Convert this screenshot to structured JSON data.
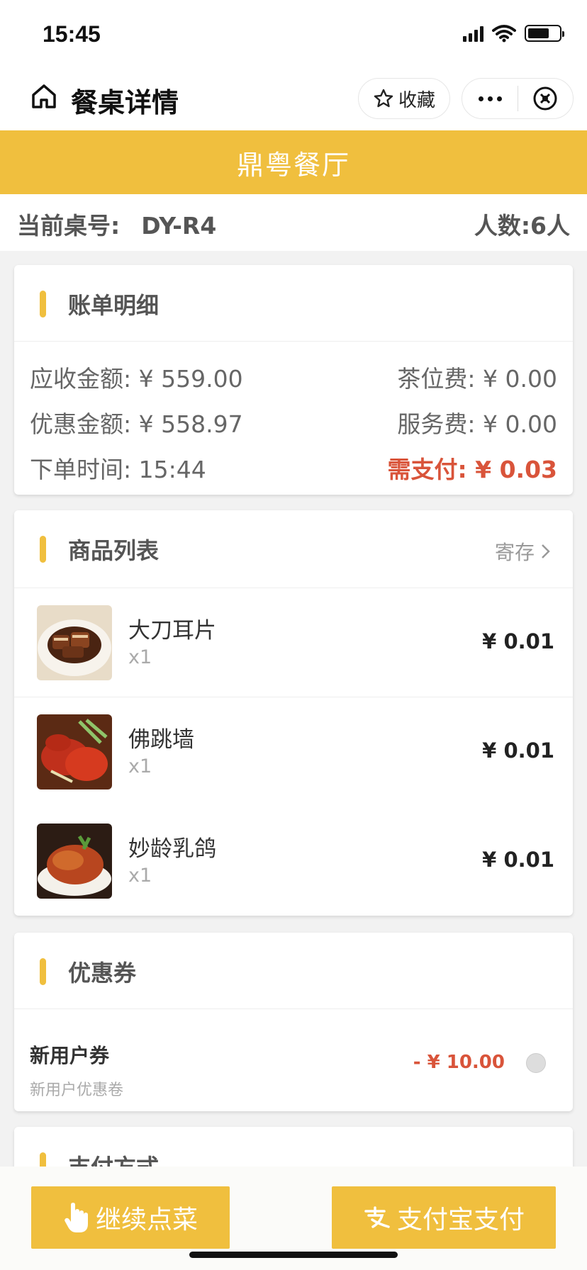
{
  "status_bar": {
    "time": "15:45"
  },
  "nav": {
    "title": "餐桌详情",
    "favorite_label": "收藏"
  },
  "brand": {
    "name": "鼎粤餐厅"
  },
  "table_info": {
    "table_label": "当前桌号:",
    "table_no": "DY-R4",
    "people_text": "人数:6人"
  },
  "bill": {
    "title": "账单明细",
    "receivable": "应收金额: ¥ 559.00",
    "tea_fee": "茶位费: ¥ 0.00",
    "discount": "优惠金额: ¥ 558.97",
    "service_fee": "服务费: ¥ 0.00",
    "order_time": "下单时间: 15:44",
    "need_pay": "需支付: ¥ 0.03"
  },
  "goods": {
    "title": "商品列表",
    "deposit_label": "寄存",
    "items": [
      {
        "name": "大刀耳片",
        "qty": "x1",
        "price": "¥ 0.01"
      },
      {
        "name": "佛跳墙",
        "qty": "x1",
        "price": "¥ 0.01"
      },
      {
        "name": "妙龄乳鸽",
        "qty": "x1",
        "price": "¥ 0.01"
      }
    ]
  },
  "coupon": {
    "title": "优惠券",
    "name": "新用户券",
    "desc": "新用户优惠卷",
    "amount": "- ¥ 10.00"
  },
  "payment": {
    "title": "支付方式"
  },
  "actions": {
    "continue_label": "继续点菜",
    "alipay_label": "支付宝支付"
  },
  "colors": {
    "accent": "#f0bf3e",
    "price_red": "#d9543a"
  }
}
